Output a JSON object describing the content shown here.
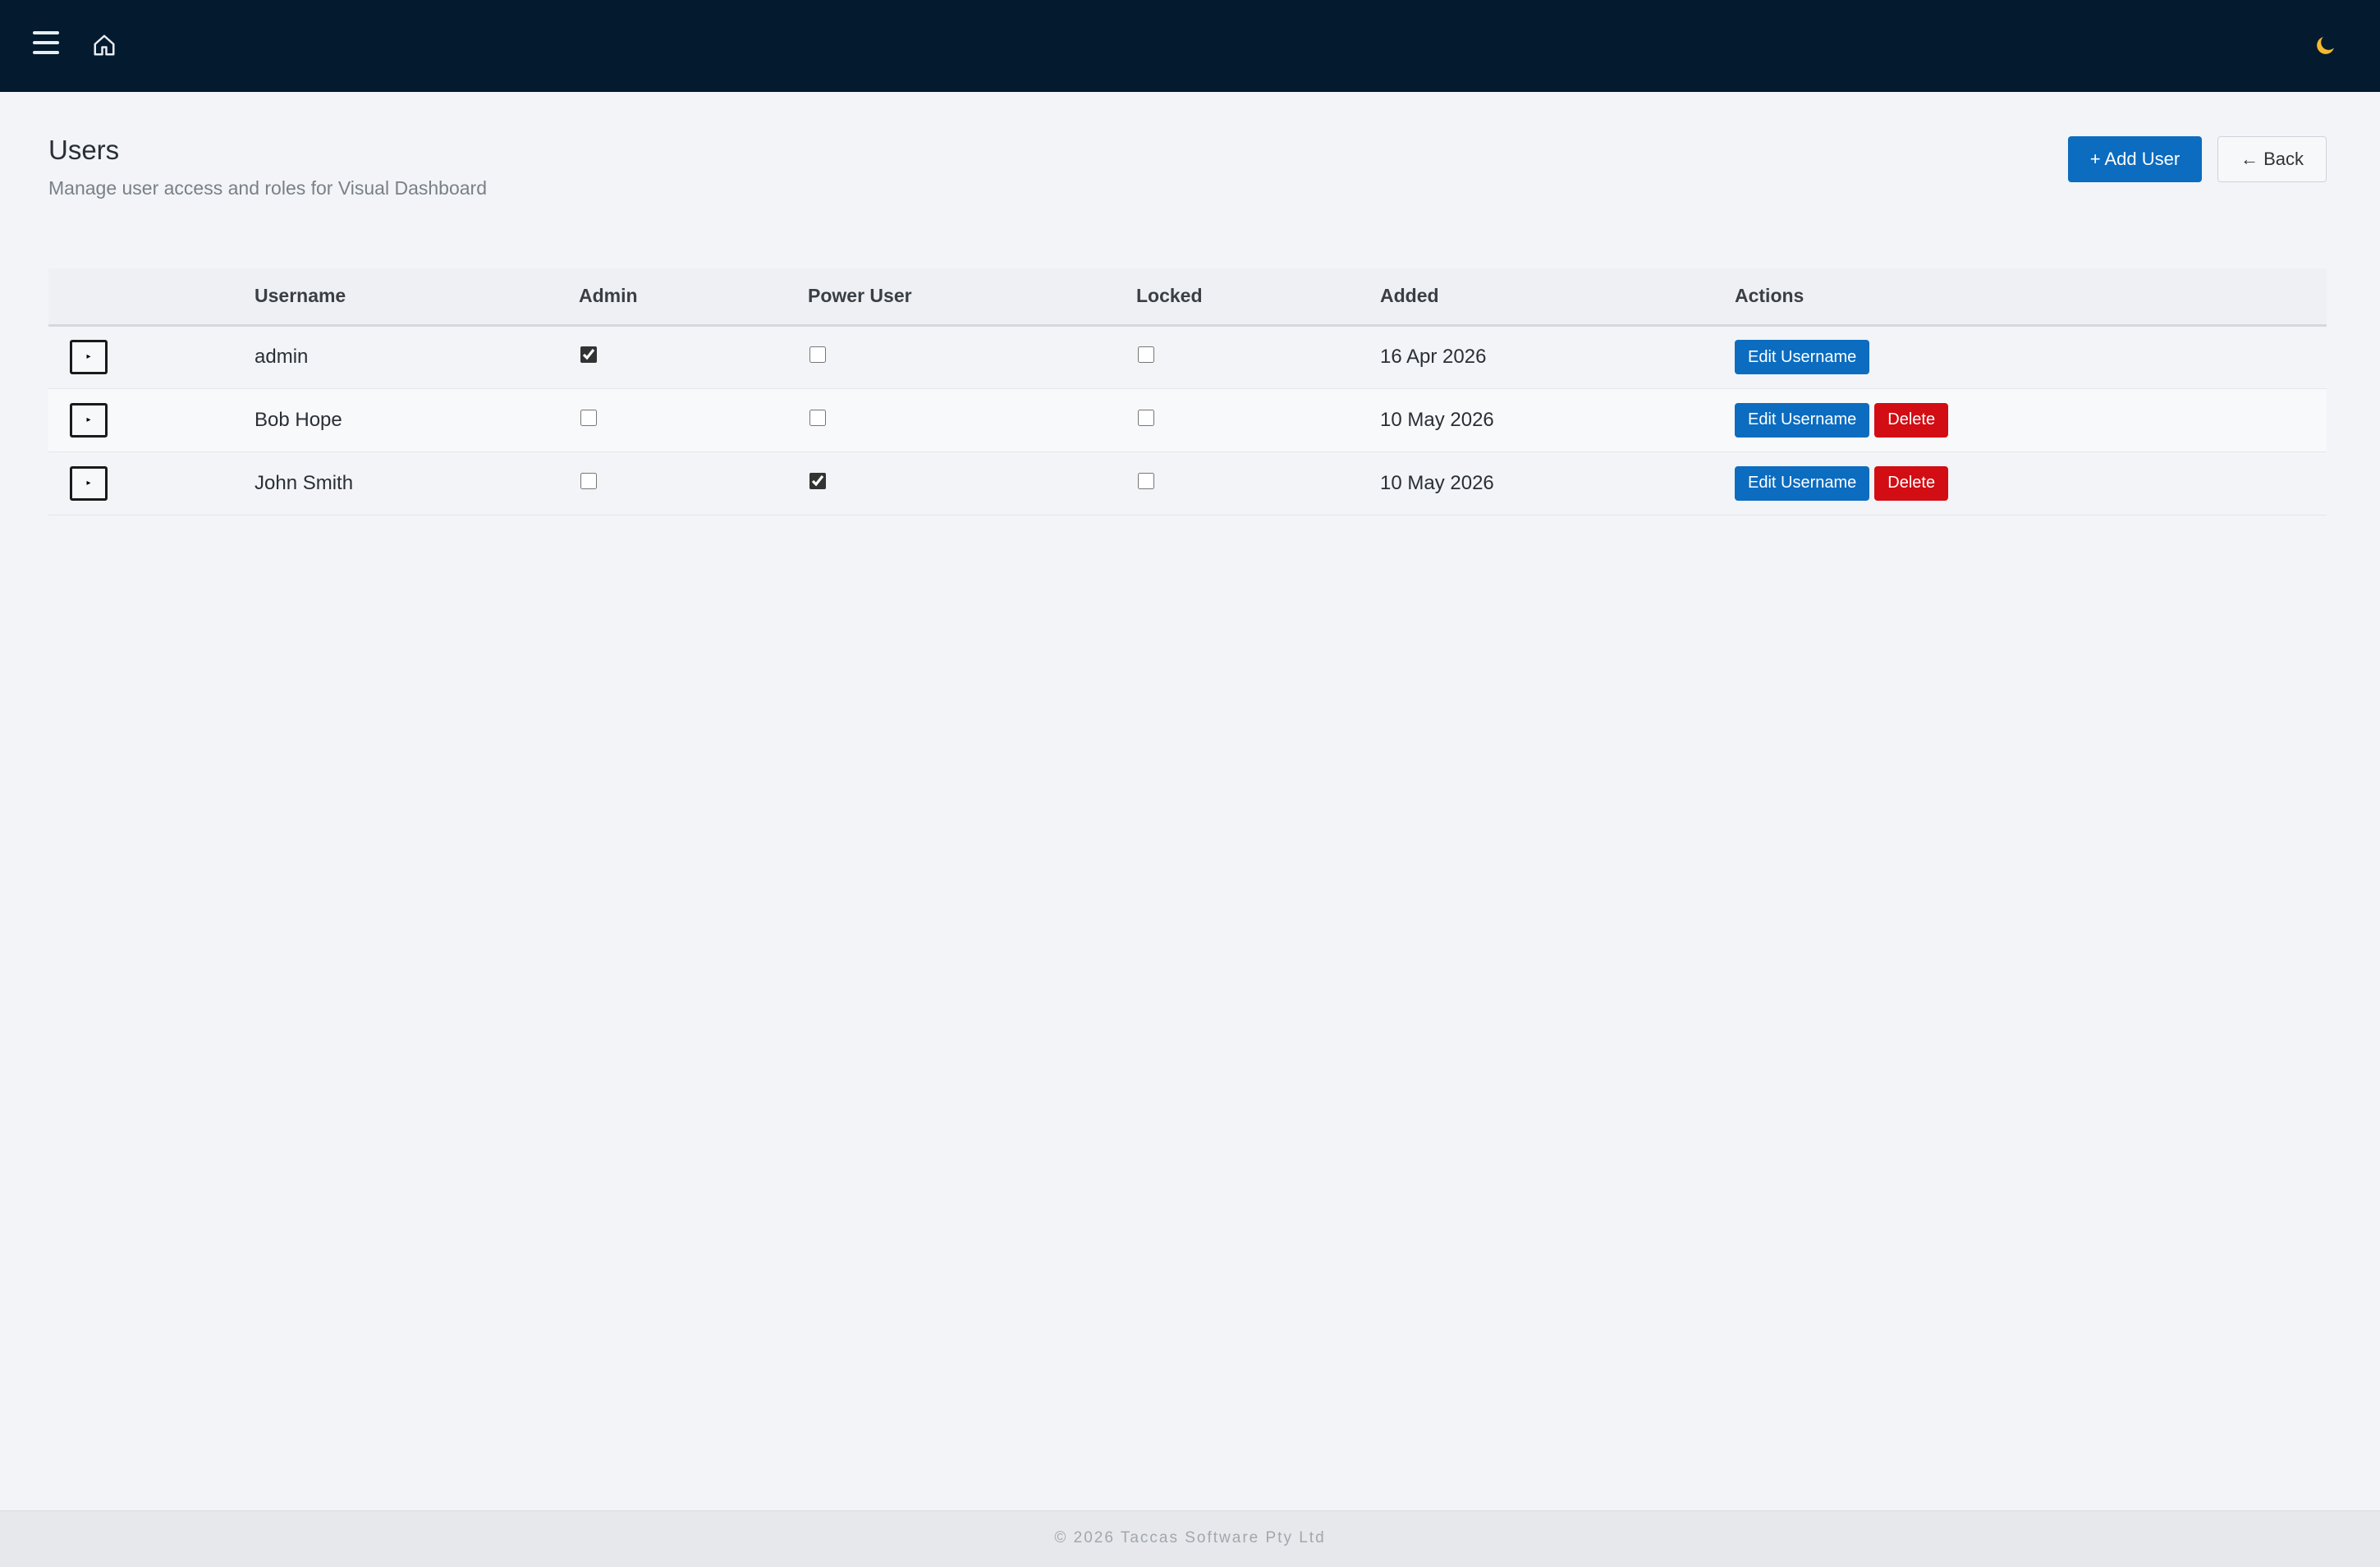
{
  "topbar": {
    "menu_icon": "hamburger-menu-icon",
    "home_icon": "home-icon",
    "theme_icon": "moon-icon"
  },
  "page": {
    "title": "Users",
    "subtitle": "Manage user access and roles for Visual Dashboard"
  },
  "actions": {
    "add_user_label": "+ Add User",
    "back_label": "← Back"
  },
  "table": {
    "columns": [
      "",
      "Username",
      "Admin",
      "Power User",
      "Locked",
      "Added",
      "Actions"
    ],
    "rows": [
      {
        "username": "admin",
        "admin": true,
        "power_user": false,
        "locked": false,
        "added": "16 Apr 2026",
        "edit_label": "Edit Username",
        "delete_label": null
      },
      {
        "username": "Bob Hope",
        "admin": false,
        "power_user": false,
        "locked": false,
        "added": "10 May 2026",
        "edit_label": "Edit Username",
        "delete_label": "Delete"
      },
      {
        "username": "John Smith",
        "admin": false,
        "power_user": true,
        "locked": false,
        "added": "10 May 2026",
        "edit_label": "Edit Username",
        "delete_label": "Delete"
      }
    ],
    "expand_glyph": "▸"
  },
  "footer": {
    "text": "© 2026 Taccas Software Pty Ltd"
  },
  "colors": {
    "topbar": "#041a2e",
    "primary": "#0b6cc0",
    "danger": "#d20d13",
    "background": "#f2f4f7",
    "theme_icon": "#f5b82e"
  }
}
